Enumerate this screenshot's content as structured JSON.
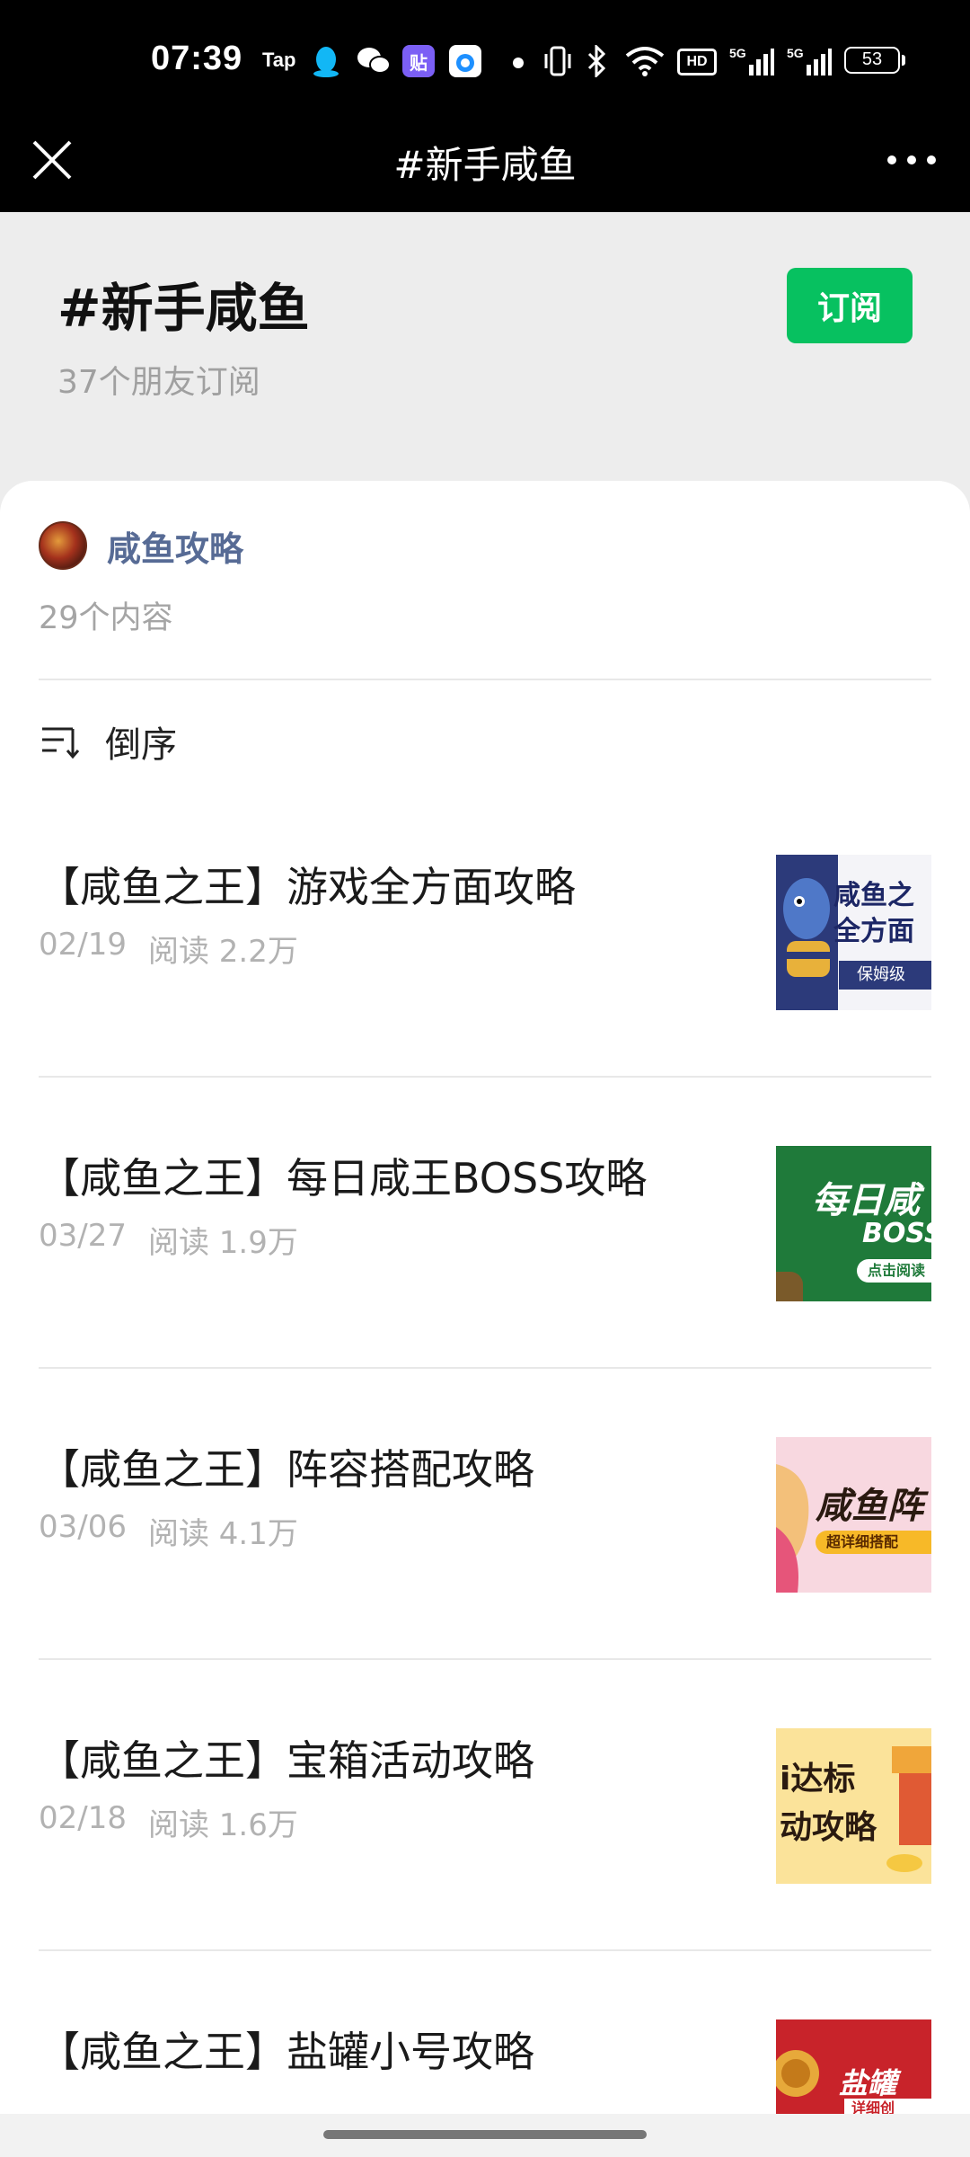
{
  "status_bar": {
    "time": "07:39",
    "tap_label": "Tap",
    "tieba_label": "贴",
    "hd_label": "HD",
    "signal1_label": "5G",
    "signal2_label": "5G",
    "battery": "53",
    "icons": [
      "qq-icon",
      "wechat-icon",
      "tieba-icon",
      "app-icon",
      "dot-icon",
      "vibrate-icon",
      "bluetooth-icon",
      "wifi-icon",
      "hd-icon",
      "signal-5g-icon",
      "signal-5g-icon",
      "battery-icon"
    ]
  },
  "nav": {
    "title": "#新手咸鱼",
    "close_icon": "close-icon",
    "more_icon": "more-icon"
  },
  "topic": {
    "title": "#新手咸鱼",
    "subscribers": "37个朋友订阅",
    "subscribe_label": "订阅",
    "accent": "#07c160"
  },
  "author": {
    "name": "咸鱼攻略",
    "count": "29个内容",
    "name_color": "#576b95"
  },
  "sort": {
    "label": "倒序",
    "icon": "sort-icon"
  },
  "articles": [
    {
      "title": "【咸鱼之王】游戏全方面攻略",
      "date": "02/19",
      "reads": "阅读 2.2万",
      "thumb_text": "咸鱼之\n全方面",
      "thumb_tag": "保姆级"
    },
    {
      "title": "【咸鱼之王】每日咸王BOSS攻略",
      "date": "03/27",
      "reads": "阅读 1.9万",
      "thumb_text": "每日咸",
      "thumb_sub": "BOSS",
      "thumb_tag": "点击阅读"
    },
    {
      "title": "【咸鱼之王】阵容搭配攻略",
      "date": "03/06",
      "reads": "阅读 4.1万",
      "thumb_text": "咸鱼阵",
      "thumb_tag": "超详细搭配"
    },
    {
      "title": "【咸鱼之王】宝箱活动攻略",
      "date": "02/18",
      "reads": "阅读 1.6万",
      "thumb_text": "i达标\n动攻略"
    },
    {
      "title": "【咸鱼之王】盐罐小号攻略",
      "date": "",
      "reads": "",
      "thumb_text": "盐罐",
      "thumb_tag": "详细创"
    }
  ]
}
